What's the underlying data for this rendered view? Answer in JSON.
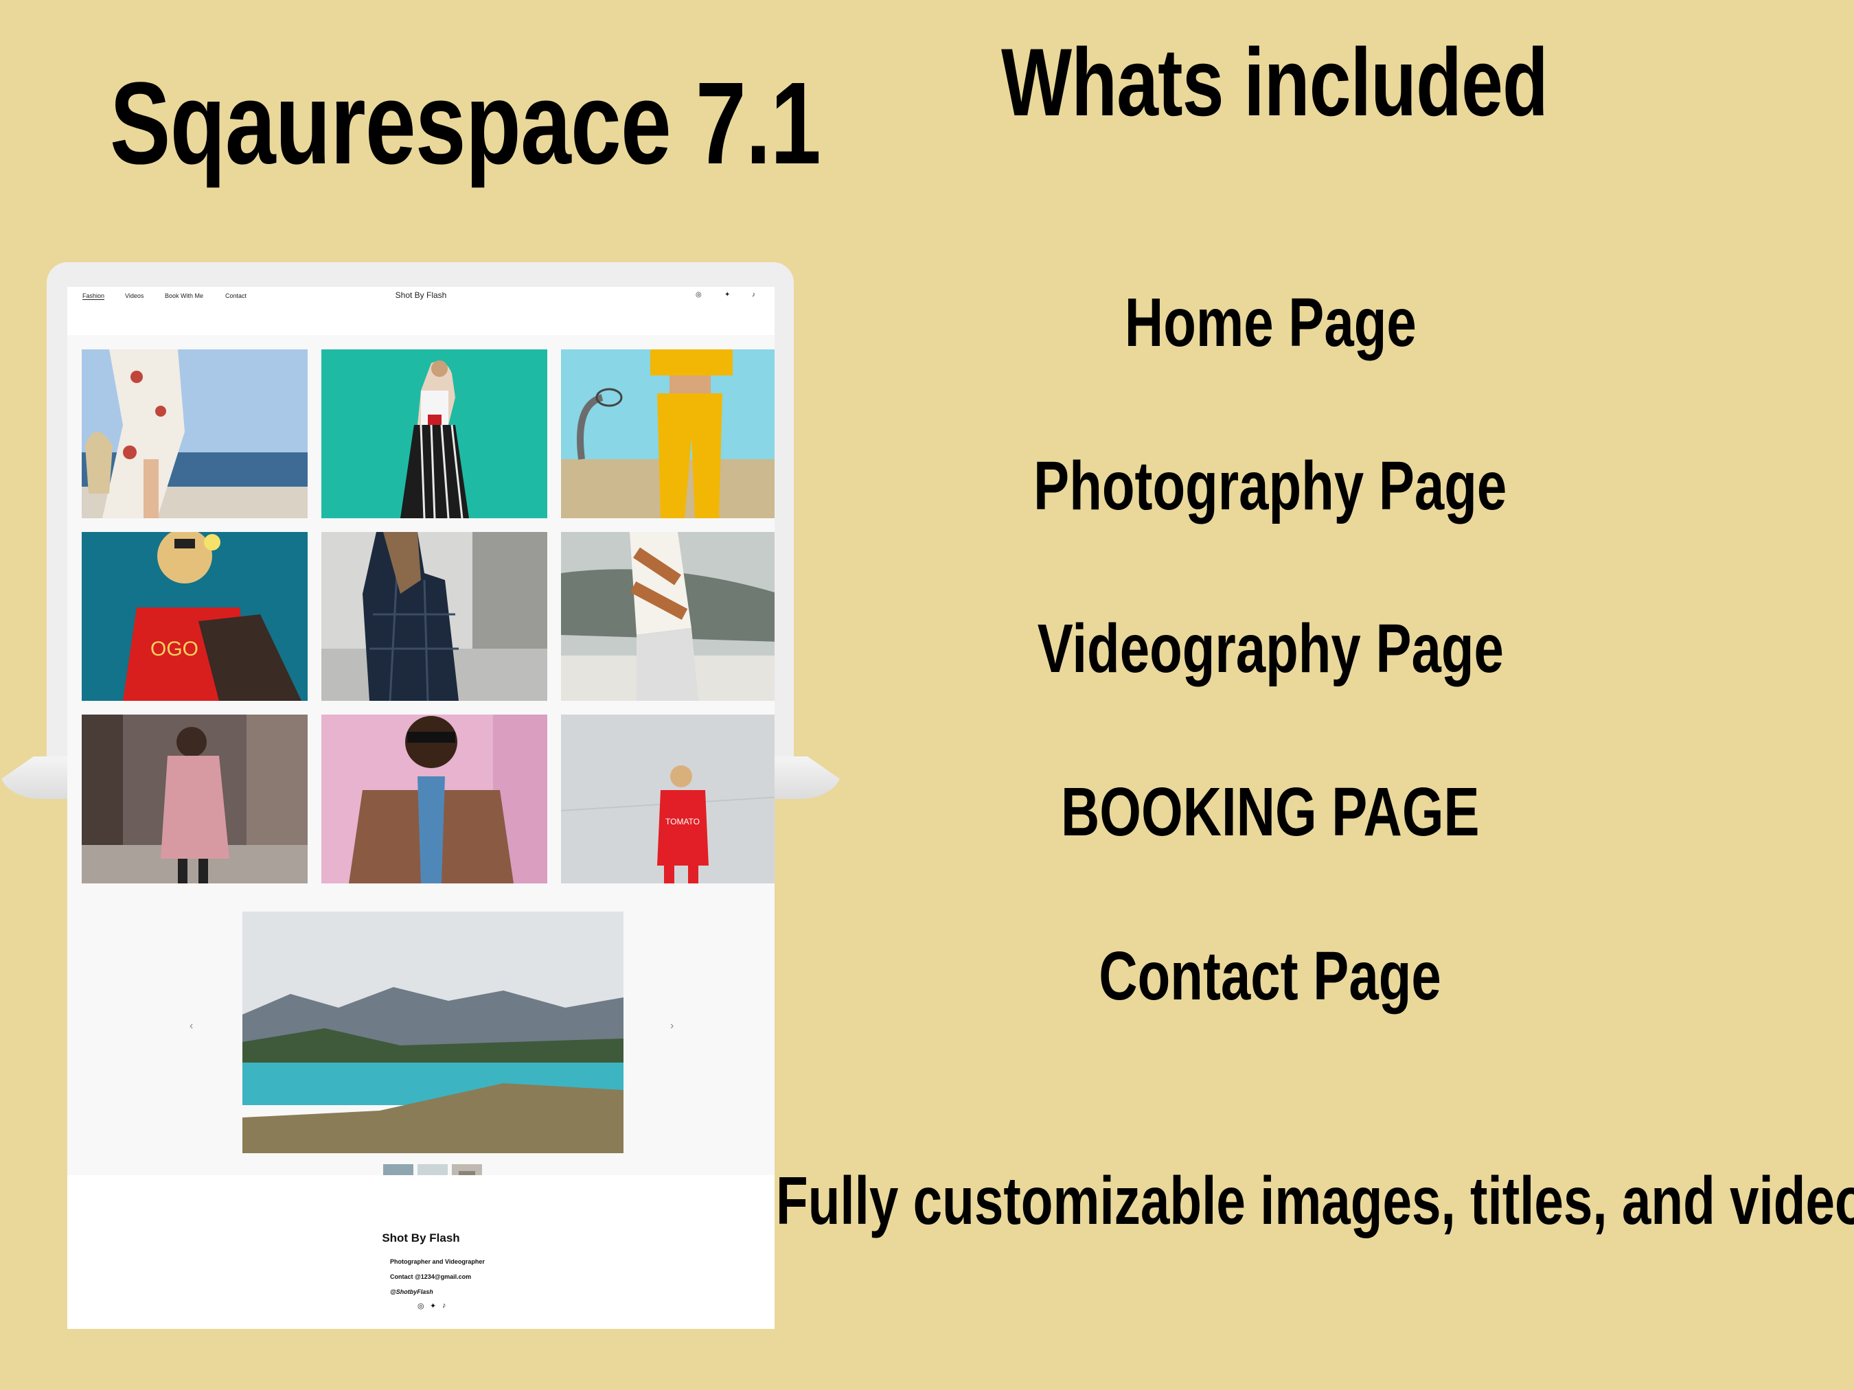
{
  "headline": {
    "left_title": "Sqaurespace 7.1",
    "right_title": "Whats included"
  },
  "features": [
    "Home Page",
    "Photography Page",
    "Videography Page",
    "BOOKING PAGE",
    "Contact Page"
  ],
  "tagline": "Fully customizable images, titles, and videos",
  "site": {
    "nav": [
      "Fashion",
      "Videos",
      "Book With Me",
      "Contact"
    ],
    "title": "Shot By Flash",
    "icons": [
      "instagram-icon",
      "twitter-icon",
      "tiktok-icon"
    ],
    "slideshow": {
      "prev": "‹",
      "next": "›"
    },
    "footer": {
      "name": "Shot By Flash",
      "role": "Photographer and Videographer",
      "email": "Contact @1234@gmail.com",
      "handle": "@ShotbyFlash"
    }
  },
  "colors": {
    "background": "#e9d89a",
    "text": "#000000",
    "screen": "#ffffff"
  }
}
